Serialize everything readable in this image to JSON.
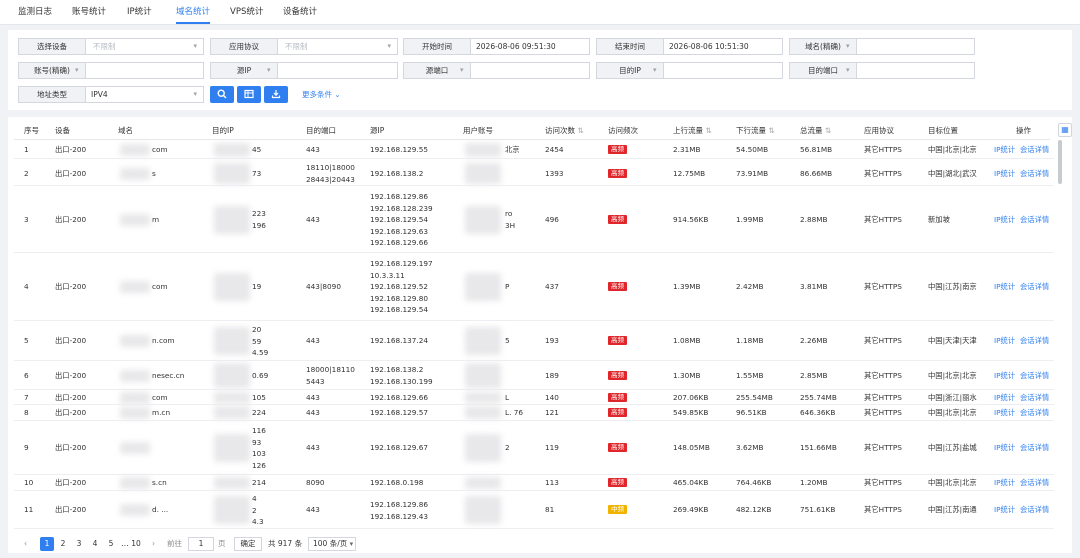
{
  "tabs": [
    "监测日志",
    "账号统计",
    "IP统计",
    "域名统计",
    "VPS统计",
    "设备统计"
  ],
  "active_tab": "域名统计",
  "filters": {
    "device_label": "选择设备",
    "device_value": "不限制",
    "protocol_label": "应用协议",
    "protocol_value": "不限制",
    "start_label": "开始时间",
    "start_value": "2026-08-06 09:51:30",
    "end_label": "结束时间",
    "end_value": "2026-08-06 10:51:30",
    "domain_label": "域名(精确)",
    "account_label": "账号(精确)",
    "src_ip_label": "源IP",
    "src_port_label": "源端口",
    "dst_ip_label": "目的IP",
    "dst_port_label": "目的端口",
    "addr_type_label": "地址类型",
    "addr_type_value": "IPV4",
    "more_label": "更多条件"
  },
  "columns": [
    "序号",
    "设备",
    "域名",
    "目的IP",
    "目的端口",
    "源IP",
    "用户账号",
    "访问次数",
    "访问频次",
    "上行流量",
    "下行流量",
    "总流量",
    "应用协议",
    "目标位置",
    "操作"
  ],
  "actions": {
    "ip_stat": "IP统计",
    "session": "会话详情"
  },
  "rows": [
    {
      "no": "1",
      "device": "出口-200",
      "domain": "com",
      "dst_ip": "45",
      "dst_port": "443",
      "src_ip": "192.168.129.55",
      "account": "北京",
      "count": "2454",
      "freq": "高频",
      "up": "2.31MB",
      "down": "54.50MB",
      "total": "56.81MB",
      "proto": "其它HTTPS",
      "loc": "中国|北京|北京"
    },
    {
      "no": "2",
      "device": "出口-200",
      "domain": "s",
      "dst_ip": "73",
      "dst_port": "18110|18000\n28443|20443",
      "src_ip": "192.168.138.2",
      "account": "",
      "count": "1393",
      "freq": "高频",
      "up": "12.75MB",
      "down": "73.91MB",
      "total": "86.66MB",
      "proto": "其它HTTPS",
      "loc": "中国|湖北|武汉"
    },
    {
      "no": "3",
      "device": "出口-200",
      "domain": "m",
      "dst_ip": "223\n196",
      "dst_port": "443",
      "src_ip": "192.168.129.86\n192.168.128.239\n192.168.129.54\n192.168.129.63\n192.168.129.66",
      "account": "ro\n3H",
      "count": "496",
      "freq": "高频",
      "up": "914.56KB",
      "down": "1.99MB",
      "total": "2.88MB",
      "proto": "其它HTTPS",
      "loc": "新加坡"
    },
    {
      "no": "4",
      "device": "出口-200",
      "domain": "com",
      "dst_ip": "19",
      "dst_port": "443|8090",
      "src_ip": "192.168.129.197\n10.3.3.11\n192.168.129.52\n192.168.129.80\n192.168.129.54",
      "account": "P",
      "count": "437",
      "freq": "高频",
      "up": "1.39MB",
      "down": "2.42MB",
      "total": "3.81MB",
      "proto": "其它HTTPS",
      "loc": "中国|江苏|南京"
    },
    {
      "no": "5",
      "device": "出口-200",
      "domain": "n.com",
      "dst_ip": "20\n59\n4.59",
      "dst_port": "443",
      "src_ip": "192.168.137.24",
      "account": "5",
      "count": "193",
      "freq": "高频",
      "up": "1.08MB",
      "down": "1.18MB",
      "total": "2.26MB",
      "proto": "其它HTTPS",
      "loc": "中国|天津|天津"
    },
    {
      "no": "6",
      "device": "出口-200",
      "domain": "nesec.cn",
      "dst_ip": "0.69",
      "dst_port": "18000|18110\n5443",
      "src_ip": "192.168.138.2\n192.168.130.199",
      "account": "",
      "count": "189",
      "freq": "高频",
      "up": "1.30MB",
      "down": "1.55MB",
      "total": "2.85MB",
      "proto": "其它HTTPS",
      "loc": "中国|北京|北京"
    },
    {
      "no": "7",
      "device": "出口-200",
      "domain": "com",
      "dst_ip": "105",
      "dst_port": "443",
      "src_ip": "192.168.129.66",
      "account": "L",
      "count": "140",
      "freq": "高频",
      "up": "207.06KB",
      "down": "255.54MB",
      "total": "255.74MB",
      "proto": "其它HTTPS",
      "loc": "中国|浙江|丽水"
    },
    {
      "no": "8",
      "device": "出口-200",
      "domain": "m.cn",
      "dst_ip": "224",
      "dst_port": "443",
      "src_ip": "192.168.129.57",
      "account": "L. 76",
      "count": "121",
      "freq": "高频",
      "up": "549.85KB",
      "down": "96.51KB",
      "total": "646.36KB",
      "proto": "其它HTTPS",
      "loc": "中国|北京|北京"
    },
    {
      "no": "9",
      "device": "出口-200",
      "domain": "",
      "dst_ip": "116\n93\n103\n126",
      "dst_port": "443",
      "src_ip": "192.168.129.67",
      "account": "2",
      "count": "119",
      "freq": "高频",
      "up": "148.05MB",
      "down": "3.62MB",
      "total": "151.66MB",
      "proto": "其它HTTPS",
      "loc": "中国|江苏|盐城"
    },
    {
      "no": "10",
      "device": "出口-200",
      "domain": "s.cn",
      "dst_ip": "214",
      "dst_port": "8090",
      "src_ip": "192.168.0.198",
      "account": "",
      "count": "113",
      "freq": "高频",
      "up": "465.04KB",
      "down": "764.46KB",
      "total": "1.20MB",
      "proto": "其它HTTPS",
      "loc": "中国|北京|北京"
    },
    {
      "no": "11",
      "device": "出口-200",
      "domain": "d. ...",
      "dst_ip": "4\n2\n4.3",
      "dst_port": "443",
      "src_ip": "192.168.129.86\n192.168.129.43",
      "account": "",
      "count": "81",
      "freq": "中频",
      "up": "269.49KB",
      "down": "482.12KB",
      "total": "751.61KB",
      "proto": "其它HTTPS",
      "loc": "中国|江苏|南通"
    }
  ],
  "pager": {
    "pages": [
      "1",
      "2",
      "3",
      "4",
      "5",
      "...",
      "10"
    ],
    "goto_label": "前往",
    "goto_value": "1",
    "page_unit": "页",
    "confirm": "确定",
    "total": "共 917 条",
    "page_size": "100 条/页"
  },
  "colors": {
    "accent": "#2f7ff0",
    "high": "#e0262b",
    "mid": "#f0b400"
  }
}
